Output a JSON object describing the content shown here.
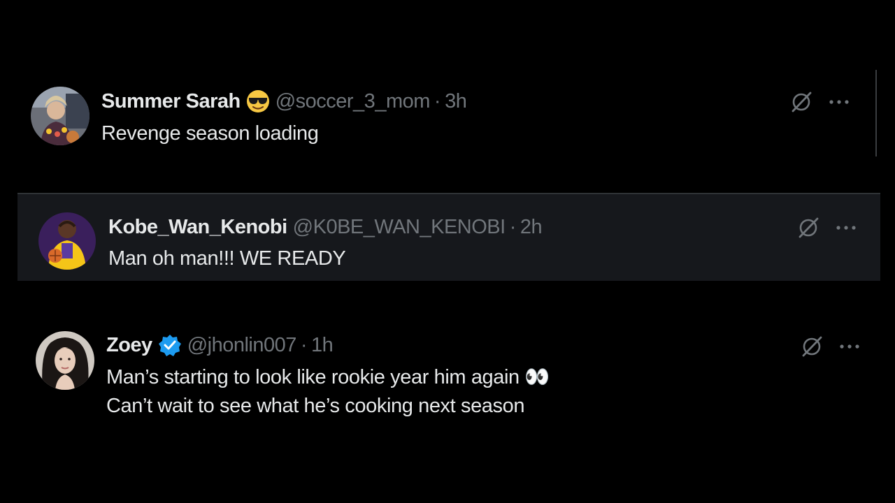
{
  "tweets": [
    {
      "name": "Summer Sarah",
      "badge": "sunglasses-emoji",
      "handle": "@soccer_3_mom",
      "separator": "·",
      "time": "3h",
      "text": "Revenge season loading"
    },
    {
      "name": "Kobe_Wan_Kenobi",
      "handle": "@K0BE_WAN_KENOBI",
      "separator": "·",
      "time": "2h",
      "text": "Man oh man!!! WE READY"
    },
    {
      "name": "Zoey",
      "badge": "verified-badge",
      "handle": "@jhonlin007",
      "separator": "·",
      "time": "1h",
      "lines": [
        "Man’s starting to look like rookie year him again 👀",
        "Can’t wait to see what he’s cooking next season"
      ]
    }
  ],
  "colors": {
    "background": "#000000",
    "highlight_row": "#16181c",
    "primary_text": "#e7e9ea",
    "secondary_text": "#71767b",
    "verified": "#1d9bf0"
  }
}
